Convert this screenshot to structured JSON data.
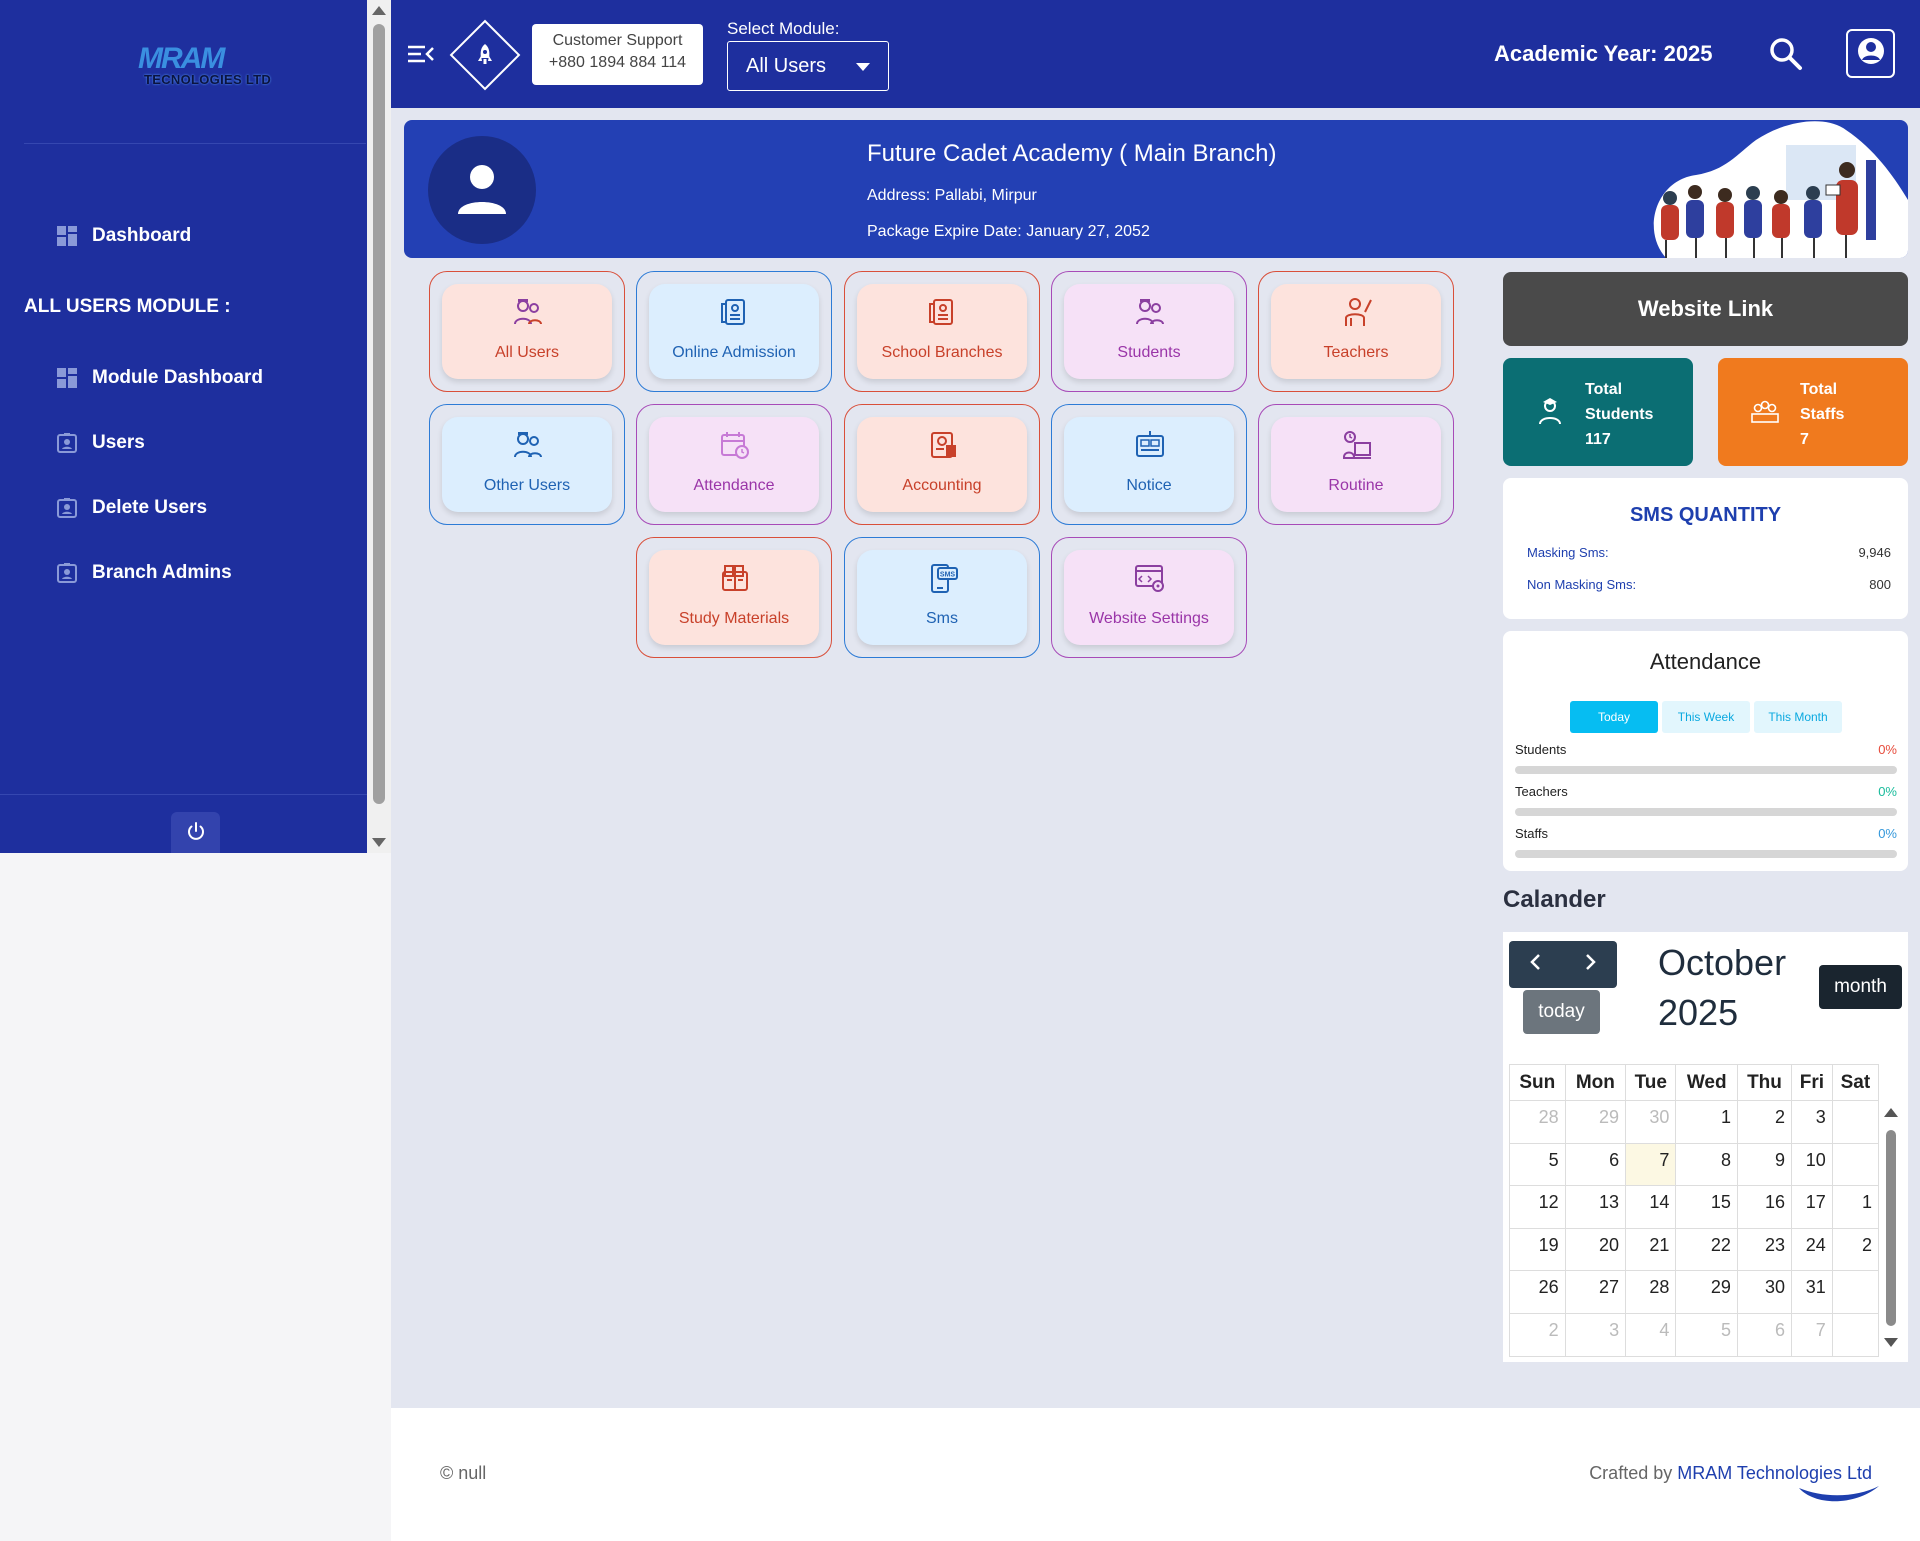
{
  "brand": {
    "logo_mark": "MRAM",
    "logo_text": "TECNOLOGIES LTD"
  },
  "sidebar": {
    "dashboard": "Dashboard",
    "section_heading": "ALL USERS MODULE :",
    "items": [
      {
        "label": "Module Dashboard",
        "icon": "grid-icon"
      },
      {
        "label": "Users",
        "icon": "id-card-icon"
      },
      {
        "label": "Delete Users",
        "icon": "id-card-icon"
      },
      {
        "label": "Branch Admins",
        "icon": "id-card-icon"
      }
    ],
    "power_icon": "power-icon"
  },
  "topbar": {
    "support_title": "Customer Support",
    "support_phone": "+880 1894 884 114",
    "select_label": "Select Module:",
    "select_value": "All Users",
    "academic_year": "Academic Year: 2025"
  },
  "banner": {
    "name": "Future Cadet Academy ( Main Branch)",
    "address": "Address: Pallabi, Mirpur",
    "expire": "Package Expire Date: January 27, 2052"
  },
  "modules": [
    {
      "label": "All Users",
      "theme": "red"
    },
    {
      "label": "Online Admission",
      "theme": "blue"
    },
    {
      "label": "School Branches",
      "theme": "red"
    },
    {
      "label": "Students",
      "theme": "purple"
    },
    {
      "label": "Teachers",
      "theme": "red"
    },
    {
      "label": "Other Users",
      "theme": "blue"
    },
    {
      "label": "Attendance",
      "theme": "purple"
    },
    {
      "label": "Accounting",
      "theme": "red"
    },
    {
      "label": "Notice",
      "theme": "blue"
    },
    {
      "label": "Routine",
      "theme": "purple"
    },
    {
      "label": "Study Materials",
      "theme": "red"
    },
    {
      "label": "Sms",
      "theme": "blue"
    },
    {
      "label": "Website Settings",
      "theme": "purple"
    }
  ],
  "website_link": "Website Link",
  "stats": {
    "students": {
      "l1": "Total",
      "l2": "Students",
      "value": "117",
      "color": "#0b6e73"
    },
    "staffs": {
      "l1": "Total",
      "l2": "Staffs",
      "value": "7",
      "color": "#f07a1e"
    }
  },
  "sms": {
    "title": "SMS QUANTITY",
    "masking_label": "Masking Sms:",
    "masking_value": "9,946",
    "non_masking_label": "Non Masking Sms:",
    "non_masking_value": "800"
  },
  "attendance": {
    "title": "Attendance",
    "tabs": [
      "Today",
      "This Week",
      "This Month"
    ],
    "rows": [
      {
        "label": "Students",
        "pct": "0%",
        "color": "#e74c3c"
      },
      {
        "label": "Teachers",
        "pct": "0%",
        "color": "#1abc9c"
      },
      {
        "label": "Staffs",
        "pct": "0%",
        "color": "#3498db"
      }
    ]
  },
  "calendar": {
    "heading": "Calander",
    "title_month": "October",
    "title_year": "2025",
    "today_label": "today",
    "month_label": "month",
    "weekdays": [
      "Sun",
      "Mon",
      "Tue",
      "Wed",
      "Thu",
      "Fri",
      "Sat"
    ],
    "weeks": [
      [
        "28",
        "29",
        "30",
        "1",
        "2",
        "3",
        ""
      ],
      [
        "5",
        "6",
        "7",
        "8",
        "9",
        "10",
        ""
      ],
      [
        "12",
        "13",
        "14",
        "15",
        "16",
        "17",
        "1"
      ],
      [
        "19",
        "20",
        "21",
        "22",
        "23",
        "24",
        "2"
      ],
      [
        "26",
        "27",
        "28",
        "29",
        "30",
        "31",
        ""
      ],
      [
        "2",
        "3",
        "4",
        "5",
        "6",
        "7",
        ""
      ]
    ]
  },
  "footer": {
    "copyright": "© null",
    "crafted_prefix": "Crafted by ",
    "crafted_link": "MRAM Technologies Ltd"
  }
}
